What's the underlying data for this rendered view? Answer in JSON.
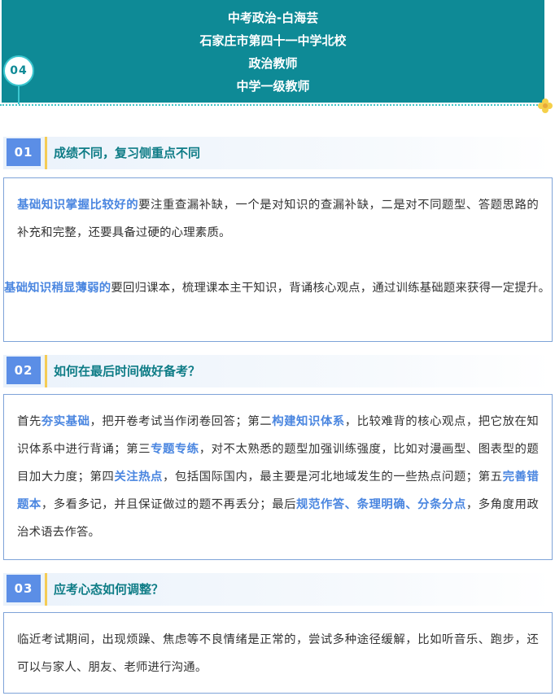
{
  "header": {
    "lines": [
      "中考政治-白海芸",
      "石家庄市第四十一中学北校",
      "政治教师",
      "中学一级教师"
    ],
    "badge": "04"
  },
  "sections": [
    {
      "num": "01",
      "title": "成绩不同，复习侧重点不同",
      "p1": [
        {
          "t": "基础知识掌握比较好的",
          "hl": true
        },
        {
          "t": "要注重查漏补缺，一个是对知识的查漏补缺，二是对不同题型、答题思路的补充和完整，还要具备过硬的心理素质。",
          "hl": false
        }
      ],
      "p2": [
        {
          "t": "基础知识稍显薄弱的",
          "hl": true
        },
        {
          "t": "要回归课本，梳理课本主干知识，背诵核心观点，通过训练基础题来获得一定提升。",
          "hl": false
        }
      ]
    },
    {
      "num": "02",
      "title": "如何在最后时间做好备考？",
      "p1": [
        {
          "t": "首先",
          "hl": false
        },
        {
          "t": "夯实基础",
          "hl": true
        },
        {
          "t": "，把开卷考试当作闭卷回答；第二",
          "hl": false
        },
        {
          "t": "构建知识体系",
          "hl": true
        },
        {
          "t": "，比较难背的核心观点，把它放在知识体系中进行背诵；第三",
          "hl": false
        },
        {
          "t": "专题专练",
          "hl": true
        },
        {
          "t": "，对不太熟悉的题型加强训练强度，比如对漫画型、图表型的题目加大力度；第四",
          "hl": false
        },
        {
          "t": "关注热点",
          "hl": true
        },
        {
          "t": "，包括国际国内，最主要是河北地域发生的一些热点问题；第五",
          "hl": false
        },
        {
          "t": "完善错题本",
          "hl": true
        },
        {
          "t": "，多看多记，并且保证做过的题不再丢分；最后",
          "hl": false
        },
        {
          "t": "规范作答、条理明确、分条分点",
          "hl": true
        },
        {
          "t": "，多角度用政治术语去作答。",
          "hl": false
        }
      ]
    },
    {
      "num": "03",
      "title": "应考心态如何调整？",
      "p1": [
        {
          "t": "临近考试期间，出现烦躁、焦虑等不良情绪是正常的，尝试多种途径缓解，比如听音乐、跑步，还可以与家人、朋友、老师进行沟通。",
          "hl": false
        }
      ]
    }
  ],
  "colors": {
    "header_bg": "#0e8a96",
    "accent": "#4a86e0",
    "badge_bg": "#5b8ee6",
    "title": "#0e7c86",
    "bar": "#f5cc55"
  },
  "icons": {
    "corner": "flower-icon"
  }
}
